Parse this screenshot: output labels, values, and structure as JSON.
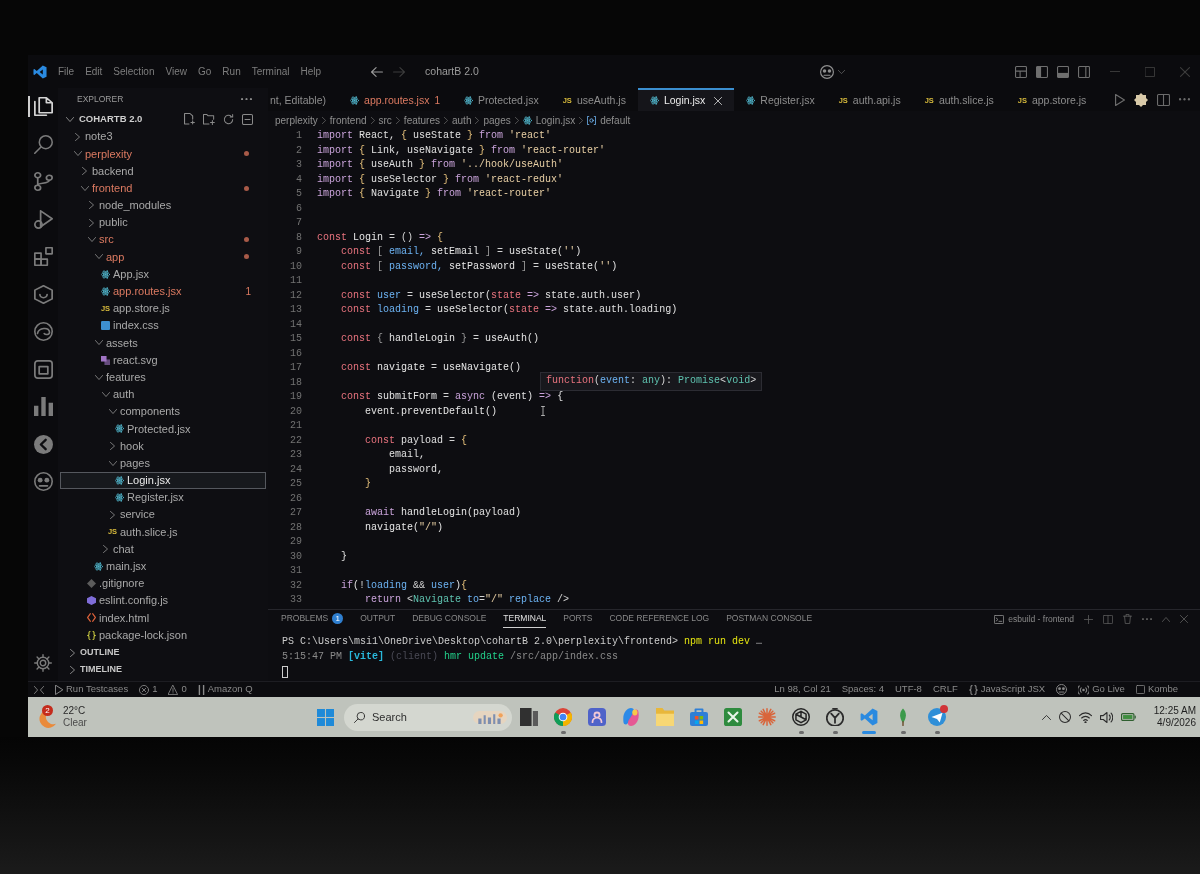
{
  "window": {
    "title": "cohartB 2.0",
    "menu": [
      "File",
      "Edit",
      "Selection",
      "View",
      "Go",
      "Run",
      "Terminal",
      "Help"
    ]
  },
  "activity_bar": {
    "items": [
      {
        "kind": "files",
        "selected": true
      },
      {
        "kind": "search",
        "selected": false
      },
      {
        "kind": "branch",
        "selected": false
      },
      {
        "kind": "debug",
        "selected": false
      },
      {
        "kind": "blocks",
        "selected": false
      },
      {
        "kind": "hexagon",
        "selected": false
      },
      {
        "kind": "swirl",
        "selected": false
      },
      {
        "kind": "jar",
        "selected": false
      },
      {
        "kind": "bars",
        "selected": false
      },
      {
        "kind": "arrow",
        "selected": false
      },
      {
        "kind": "goggles",
        "selected": false
      }
    ]
  },
  "sidebar": {
    "title": "EXPLORER",
    "root": {
      "label": "COHARTB 2.0",
      "expanded": true,
      "children": [
        {
          "label": "note3",
          "kind": "folder",
          "expanded": false,
          "selected": false,
          "problems": false
        },
        {
          "label": "perplexity",
          "kind": "folder",
          "expanded": true,
          "selected": false,
          "problems": true,
          "children": [
            {
              "label": "backend",
              "kind": "folder",
              "expanded": false,
              "selected": false,
              "problems": false
            },
            {
              "label": "frontend",
              "kind": "folder",
              "expanded": true,
              "selected": false,
              "problems": true,
              "children": [
                {
                  "label": "node_modules",
                  "kind": "folder",
                  "expanded": false,
                  "selected": false,
                  "problems": false
                },
                {
                  "label": "public",
                  "kind": "folder",
                  "expanded": false,
                  "selected": false,
                  "problems": false
                },
                {
                  "label": "src",
                  "kind": "folder",
                  "expanded": true,
                  "selected": false,
                  "problems": true,
                  "children": [
                    {
                      "label": "app",
                      "kind": "folder",
                      "expanded": true,
                      "selected": false,
                      "problems": true,
                      "children": [
                        {
                          "label": "App.jsx",
                          "kind": "react",
                          "selected": false,
                          "problems": false
                        },
                        {
                          "label": "app.routes.jsx",
                          "kind": "react",
                          "selected": false,
                          "problems": true,
                          "badge": "1"
                        },
                        {
                          "label": "app.store.js",
                          "kind": "js",
                          "icon_label": "JS",
                          "selected": false,
                          "problems": false
                        },
                        {
                          "label": "index.css",
                          "kind": "css",
                          "selected": false,
                          "problems": false
                        }
                      ]
                    },
                    {
                      "label": "assets",
                      "kind": "folder",
                      "expanded": true,
                      "selected": false,
                      "problems": false,
                      "children": [
                        {
                          "label": "react.svg",
                          "kind": "svg",
                          "selected": false,
                          "problems": false
                        }
                      ]
                    },
                    {
                      "label": "features",
                      "kind": "folder",
                      "expanded": true,
                      "selected": false,
                      "problems": false,
                      "children": [
                        {
                          "label": "auth",
                          "kind": "folder",
                          "expanded": true,
                          "selected": false,
                          "problems": false,
                          "children": [
                            {
                              "label": "components",
                              "kind": "folder",
                              "expanded": true,
                              "selected": false,
                              "problems": false,
                              "children": [
                                {
                                  "label": "Protected.jsx",
                                  "kind": "react",
                                  "selected": false,
                                  "problems": false
                                }
                              ]
                            },
                            {
                              "label": "hook",
                              "kind": "folder",
                              "expanded": false,
                              "selected": false,
                              "problems": false
                            },
                            {
                              "label": "pages",
                              "kind": "folder",
                              "expanded": true,
                              "selected": false,
                              "problems": false,
                              "children": [
                                {
                                  "label": "Login.jsx",
                                  "kind": "react",
                                  "selected": true,
                                  "problems": false
                                },
                                {
                                  "label": "Register.jsx",
                                  "kind": "react",
                                  "selected": false,
                                  "problems": false
                                }
                              ]
                            },
                            {
                              "label": "service",
                              "kind": "folder",
                              "expanded": false,
                              "selected": false,
                              "problems": false
                            },
                            {
                              "label": "auth.slice.js",
                              "kind": "js",
                              "icon_label": "JS",
                              "selected": false,
                              "problems": false
                            }
                          ]
                        },
                        {
                          "label": "chat",
                          "kind": "folder",
                          "expanded": false,
                          "selected": false,
                          "problems": false
                        }
                      ]
                    },
                    {
                      "label": "main.jsx",
                      "kind": "react",
                      "selected": false,
                      "problems": false
                    }
                  ]
                },
                {
                  "label": ".gitignore",
                  "kind": "git",
                  "selected": false,
                  "problems": false
                },
                {
                  "label": "eslint.config.js",
                  "kind": "eslint",
                  "selected": false,
                  "problems": false
                },
                {
                  "label": "index.html",
                  "kind": "html",
                  "selected": false,
                  "problems": false
                },
                {
                  "label": "package-lock.json",
                  "kind": "json",
                  "selected": false,
                  "problems": false
                }
              ]
            }
          ]
        }
      ]
    },
    "sections": [
      {
        "label": "OUTLINE",
        "expanded": false
      },
      {
        "label": "TIMELINE",
        "expanded": false
      }
    ]
  },
  "tabs": [
    {
      "label": "nt, Editable)",
      "kind": "text",
      "selected": false,
      "problems": false
    },
    {
      "label": "app.routes.jsx",
      "kind": "react",
      "selected": false,
      "problems": true,
      "badge": "1"
    },
    {
      "label": "Protected.jsx",
      "kind": "react",
      "selected": false,
      "problems": false
    },
    {
      "label": "useAuth.js",
      "kind": "js",
      "icon_label": "JS",
      "selected": false,
      "problems": false
    },
    {
      "label": "Login.jsx",
      "kind": "react",
      "selected": true,
      "problems": false
    },
    {
      "label": "Register.jsx",
      "kind": "react",
      "selected": false,
      "problems": false
    },
    {
      "label": "auth.api.js",
      "kind": "js",
      "icon_label": "JS",
      "selected": false,
      "problems": false
    },
    {
      "label": "auth.slice.js",
      "kind": "js",
      "icon_label": "JS",
      "selected": false,
      "problems": false
    },
    {
      "label": "app.store.js",
      "kind": "js",
      "icon_label": "JS",
      "selected": false,
      "problems": false
    }
  ],
  "breadcrumb": [
    {
      "label": "perplexity",
      "kind": "folder"
    },
    {
      "label": "frontend",
      "kind": "folder"
    },
    {
      "label": "src",
      "kind": "folder"
    },
    {
      "label": "features",
      "kind": "folder"
    },
    {
      "label": "auth",
      "kind": "folder"
    },
    {
      "label": "pages",
      "kind": "folder"
    },
    {
      "label": "Login.jsx",
      "kind": "react"
    },
    {
      "label": "default",
      "kind": "symbol"
    }
  ],
  "editor": {
    "lines": [
      {
        "number": "1",
        "tokens": [
          {
            "text": "import",
            "kind": "keyword"
          },
          {
            "text": " React, ",
            "kind": "variable"
          },
          {
            "text": "{",
            "kind": "bracket1"
          },
          {
            "text": " useState ",
            "kind": "variable"
          },
          {
            "text": "}",
            "kind": "bracket1"
          },
          {
            "text": " from ",
            "kind": "keyword"
          },
          {
            "text": "'react'",
            "kind": "string"
          }
        ]
      },
      {
        "number": "2",
        "tokens": [
          {
            "text": "import",
            "kind": "keyword"
          },
          {
            "text": " {",
            "kind": "bracket1"
          },
          {
            "text": " Link, useNavigate ",
            "kind": "variable"
          },
          {
            "text": "}",
            "kind": "bracket1"
          },
          {
            "text": " from ",
            "kind": "keyword"
          },
          {
            "text": "'react-router'",
            "kind": "string"
          }
        ]
      },
      {
        "number": "3",
        "tokens": [
          {
            "text": "import",
            "kind": "keyword"
          },
          {
            "text": " {",
            "kind": "bracket1"
          },
          {
            "text": " useAuth ",
            "kind": "variable"
          },
          {
            "text": "}",
            "kind": "bracket1"
          },
          {
            "text": " from ",
            "kind": "keyword"
          },
          {
            "text": "'../hook/useAuth'",
            "kind": "string"
          }
        ]
      },
      {
        "number": "4",
        "tokens": [
          {
            "text": "import",
            "kind": "keyword"
          },
          {
            "text": " {",
            "kind": "bracket1"
          },
          {
            "text": " useSelector ",
            "kind": "variable"
          },
          {
            "text": "}",
            "kind": "bracket1"
          },
          {
            "text": " from ",
            "kind": "keyword"
          },
          {
            "text": "'react-redux'",
            "kind": "string"
          }
        ]
      },
      {
        "number": "5",
        "tokens": [
          {
            "text": "import",
            "kind": "keyword"
          },
          {
            "text": " {",
            "kind": "bracket1"
          },
          {
            "text": " Navigate ",
            "kind": "variable"
          },
          {
            "text": "}",
            "kind": "bracket1"
          },
          {
            "text": " from ",
            "kind": "keyword"
          },
          {
            "text": "'react-router'",
            "kind": "string"
          }
        ]
      },
      {
        "number": "6"
      },
      {
        "number": "7"
      },
      {
        "number": "8",
        "tokens": [
          {
            "text": "const",
            "kind": "storage"
          },
          {
            "text": " Login",
            "kind": "function"
          },
          {
            "text": " = ",
            "kind": "plain"
          },
          {
            "text": "()",
            "kind": "plain"
          },
          {
            "text": " =>",
            "kind": "keyword"
          },
          {
            "text": " {",
            "kind": "bracket1"
          }
        ]
      },
      {
        "number": "9",
        "tokens": [
          {
            "text": "    const",
            "kind": "storage"
          },
          {
            "text": " [",
            "kind": "bracket2"
          },
          {
            "text": " email, ",
            "kind": "constant"
          },
          {
            "text": "setEmail",
            "kind": "function"
          },
          {
            "text": " ]",
            "kind": "bracket2"
          },
          {
            "text": " = ",
            "kind": "plain"
          },
          {
            "text": "useState",
            "kind": "function"
          },
          {
            "text": "(",
            "kind": "bracket3"
          },
          {
            "text": "''",
            "kind": "string"
          },
          {
            "text": ")",
            "kind": "bracket3"
          }
        ]
      },
      {
        "number": "10",
        "tokens": [
          {
            "text": "    const",
            "kind": "storage"
          },
          {
            "text": " [",
            "kind": "bracket2"
          },
          {
            "text": " password, ",
            "kind": "constant"
          },
          {
            "text": "setPassword",
            "kind": "function"
          },
          {
            "text": " ]",
            "kind": "bracket2"
          },
          {
            "text": " = ",
            "kind": "plain"
          },
          {
            "text": "useState",
            "kind": "function"
          },
          {
            "text": "(",
            "kind": "bracket3"
          },
          {
            "text": "''",
            "kind": "string"
          },
          {
            "text": ")",
            "kind": "bracket3"
          }
        ]
      },
      {
        "number": "11"
      },
      {
        "number": "12",
        "tokens": [
          {
            "text": "    const",
            "kind": "storage"
          },
          {
            "text": " user",
            "kind": "constant"
          },
          {
            "text": " = ",
            "kind": "plain"
          },
          {
            "text": "useSelector",
            "kind": "function"
          },
          {
            "text": "(",
            "kind": "bracket3"
          },
          {
            "text": "state",
            "kind": "parameter"
          },
          {
            "text": " => ",
            "kind": "keyword"
          },
          {
            "text": "state.auth.user",
            "kind": "variable"
          },
          {
            "text": ")",
            "kind": "bracket3"
          }
        ]
      },
      {
        "number": "13",
        "tokens": [
          {
            "text": "    const",
            "kind": "storage"
          },
          {
            "text": " loading",
            "kind": "constant"
          },
          {
            "text": " = ",
            "kind": "plain"
          },
          {
            "text": "useSelector",
            "kind": "function"
          },
          {
            "text": "(",
            "kind": "bracket3"
          },
          {
            "text": "state",
            "kind": "parameter"
          },
          {
            "text": " => ",
            "kind": "keyword"
          },
          {
            "text": "state.auth.loading",
            "kind": "variable"
          },
          {
            "text": ")",
            "kind": "bracket3"
          }
        ]
      },
      {
        "number": "14"
      },
      {
        "number": "15",
        "tokens": [
          {
            "text": "    const",
            "kind": "storage"
          },
          {
            "text": " {",
            "kind": "bracket2"
          },
          {
            "text": " handleLogin ",
            "kind": "function"
          },
          {
            "text": "}",
            "kind": "bracket2"
          },
          {
            "text": " = ",
            "kind": "plain"
          },
          {
            "text": "useAuth",
            "kind": "function"
          },
          {
            "text": "()",
            "kind": "bracket3"
          }
        ]
      },
      {
        "number": "16"
      },
      {
        "number": "17",
        "tokens": [
          {
            "text": "    const",
            "kind": "storage"
          },
          {
            "text": " navigate",
            "kind": "function"
          },
          {
            "text": " = ",
            "kind": "plain"
          },
          {
            "text": "useNavigate",
            "kind": "function"
          },
          {
            "text": "()",
            "kind": "bracket3"
          }
        ]
      },
      {
        "number": "18"
      },
      {
        "number": "19",
        "tokens": [
          {
            "text": "    const",
            "kind": "storage"
          },
          {
            "text": " submitForm",
            "kind": "function"
          },
          {
            "text": " = ",
            "kind": "plain"
          },
          {
            "text": "async",
            "kind": "keyword"
          },
          {
            "text": " (",
            "kind": "bracket3"
          },
          {
            "text": "event",
            "kind": "variable"
          },
          {
            "text": ")",
            "kind": "bracket3"
          },
          {
            "text": " =>",
            "kind": "keyword"
          },
          {
            "text": " {",
            "kind": "bracket3"
          }
        ]
      },
      {
        "number": "20",
        "tokens": [
          {
            "text": "        event",
            "kind": "variable"
          },
          {
            "text": ".",
            "kind": "plain"
          },
          {
            "text": "preventDefault",
            "kind": "function"
          },
          {
            "text": "()",
            "kind": "bracket3"
          }
        ]
      },
      {
        "number": "21"
      },
      {
        "number": "22",
        "tokens": [
          {
            "text": "        const",
            "kind": "storage"
          },
          {
            "text": " payload",
            "kind": "variable"
          },
          {
            "text": " = ",
            "kind": "plain"
          },
          {
            "text": "{",
            "kind": "bracket1"
          }
        ]
      },
      {
        "number": "23",
        "tokens": [
          {
            "text": "            email,",
            "kind": "variable"
          }
        ]
      },
      {
        "number": "24",
        "tokens": [
          {
            "text": "            password,",
            "kind": "variable"
          }
        ]
      },
      {
        "number": "25",
        "tokens": [
          {
            "text": "        }",
            "kind": "bracket1"
          }
        ]
      },
      {
        "number": "26"
      },
      {
        "number": "27",
        "tokens": [
          {
            "text": "        await",
            "kind": "keyword"
          },
          {
            "text": " handleLogin",
            "kind": "function"
          },
          {
            "text": "(",
            "kind": "bracket3"
          },
          {
            "text": "payload",
            "kind": "variable"
          },
          {
            "text": ")",
            "kind": "bracket3"
          }
        ]
      },
      {
        "number": "28",
        "tokens": [
          {
            "text": "        navigate",
            "kind": "function"
          },
          {
            "text": "(",
            "kind": "bracket3"
          },
          {
            "text": "\"/\"",
            "kind": "string"
          },
          {
            "text": ")",
            "kind": "bracket3"
          }
        ]
      },
      {
        "number": "29"
      },
      {
        "number": "30",
        "tokens": [
          {
            "text": "    }",
            "kind": "bracket3"
          }
        ]
      },
      {
        "number": "31"
      },
      {
        "number": "32",
        "tokens": [
          {
            "text": "    if",
            "kind": "keyword"
          },
          {
            "text": "(",
            "kind": "bracket3"
          },
          {
            "text": "!",
            "kind": "plain"
          },
          {
            "text": "loading",
            "kind": "constant"
          },
          {
            "text": " && ",
            "kind": "plain"
          },
          {
            "text": "user",
            "kind": "constant"
          },
          {
            "text": ")",
            "kind": "bracket3"
          },
          {
            "text": "{",
            "kind": "bracket1"
          }
        ]
      },
      {
        "number": "33",
        "tokens": [
          {
            "text": "        return",
            "kind": "keyword"
          },
          {
            "text": " <",
            "kind": "plain"
          },
          {
            "text": "Navigate",
            "kind": "component"
          },
          {
            "text": " to",
            "kind": "constant"
          },
          {
            "text": "=",
            "kind": "plain"
          },
          {
            "text": "\"/\"",
            "kind": "string"
          },
          {
            "text": " replace",
            "kind": "constant"
          },
          {
            "text": " />",
            "kind": "plain"
          }
        ]
      }
    ],
    "hover": {
      "tokens": [
        {
          "text": "function",
          "kind": "storage"
        },
        {
          "text": "(",
          "kind": "plain"
        },
        {
          "text": "event",
          "kind": "constant"
        },
        {
          "text": ": ",
          "kind": "plain"
        },
        {
          "text": "any",
          "kind": "component"
        },
        {
          "text": "): ",
          "kind": "plain"
        },
        {
          "text": "Promise",
          "kind": "component"
        },
        {
          "text": "<",
          "kind": "plain"
        },
        {
          "text": "void",
          "kind": "component"
        },
        {
          "text": ">",
          "kind": "plain"
        }
      ]
    }
  },
  "panel": {
    "tabs": [
      {
        "label": "PROBLEMS",
        "selected": false,
        "badge": "1"
      },
      {
        "label": "OUTPUT",
        "selected": false
      },
      {
        "label": "DEBUG CONSOLE",
        "selected": false
      },
      {
        "label": "TERMINAL",
        "selected": true
      },
      {
        "label": "PORTS",
        "selected": false
      },
      {
        "label": "CODE REFERENCE LOG",
        "selected": false
      },
      {
        "label": "POSTMAN CONSOLE",
        "selected": false
      }
    ],
    "terminal": {
      "name": "esbuild - frontend",
      "lines": [
        {
          "tokens": [
            {
              "text": "PS C:\\Users\\msi1\\OneDrive\\Desktop\\cohartB 2.0\\perplexity\\frontend> ",
              "kind": "plain"
            },
            {
              "text": "npm run dev",
              "kind": "command"
            },
            {
              "text": " …",
              "kind": "plain"
            }
          ]
        },
        {
          "tokens": [
            {
              "text": "5:15:47 PM",
              "kind": "dim"
            },
            {
              "text": " [vite]",
              "kind": "tag"
            },
            {
              "text": " (client)",
              "kind": "faint"
            },
            {
              "text": " hmr update",
              "kind": "success"
            },
            {
              "text": " /src/app/index.css",
              "kind": "dim"
            }
          ]
        }
      ]
    }
  },
  "status_bar": {
    "left": [
      {
        "kind": "remote"
      },
      {
        "kind": "run",
        "label": "Run Testcases"
      },
      {
        "kind": "errors",
        "label": "1"
      },
      {
        "kind": "warnings",
        "label": "0"
      },
      {
        "kind": "bars",
        "label": "Amazon Q"
      }
    ],
    "right": [
      {
        "kind": "text",
        "label": "Ln 98, Col 21"
      },
      {
        "kind": "text",
        "label": "Spaces: 4"
      },
      {
        "kind": "text",
        "label": "UTF-8"
      },
      {
        "kind": "text",
        "label": "CRLF"
      },
      {
        "kind": "braces",
        "label": "JavaScript JSX"
      },
      {
        "kind": "goggles"
      },
      {
        "kind": "broadcast",
        "label": "Go Live"
      },
      {
        "kind": "square",
        "label": "Kombe"
      }
    ]
  },
  "taskbar": {
    "weather": {
      "badge": "2",
      "temperature": "22°C",
      "condition": "Clear"
    },
    "search": {
      "placeholder": "Search"
    },
    "apps": [
      {
        "kind": "taskview",
        "running": false,
        "focused": false,
        "notification": false
      },
      {
        "kind": "ring",
        "running": true,
        "focused": false,
        "notification": false
      },
      {
        "kind": "tile",
        "running": false,
        "focused": false,
        "notification": false
      },
      {
        "kind": "blob",
        "running": false,
        "focused": false,
        "notification": false
      },
      {
        "kind": "folder",
        "running": false,
        "focused": false,
        "notification": false
      },
      {
        "kind": "bag",
        "running": false,
        "focused": false,
        "notification": false
      },
      {
        "kind": "box",
        "running": false,
        "focused": false,
        "notification": false
      },
      {
        "kind": "starburst",
        "running": false,
        "focused": false,
        "notification": false
      },
      {
        "kind": "knot",
        "running": true,
        "focused": false,
        "notification": false
      },
      {
        "kind": "dial",
        "running": true,
        "focused": false,
        "notification": false
      },
      {
        "kind": "ribbon",
        "running": true,
        "focused": true,
        "notification": false
      },
      {
        "kind": "leaf",
        "running": true,
        "focused": false,
        "notification": false
      },
      {
        "kind": "plane",
        "running": true,
        "focused": false,
        "notification": true
      }
    ],
    "tray": [
      {
        "kind": "chevron"
      },
      {
        "kind": "slashed"
      },
      {
        "kind": "wifi"
      },
      {
        "kind": "speaker"
      },
      {
        "kind": "battery"
      }
    ],
    "clock": {
      "time": "12:25 AM",
      "date": "4/9/2026"
    }
  }
}
